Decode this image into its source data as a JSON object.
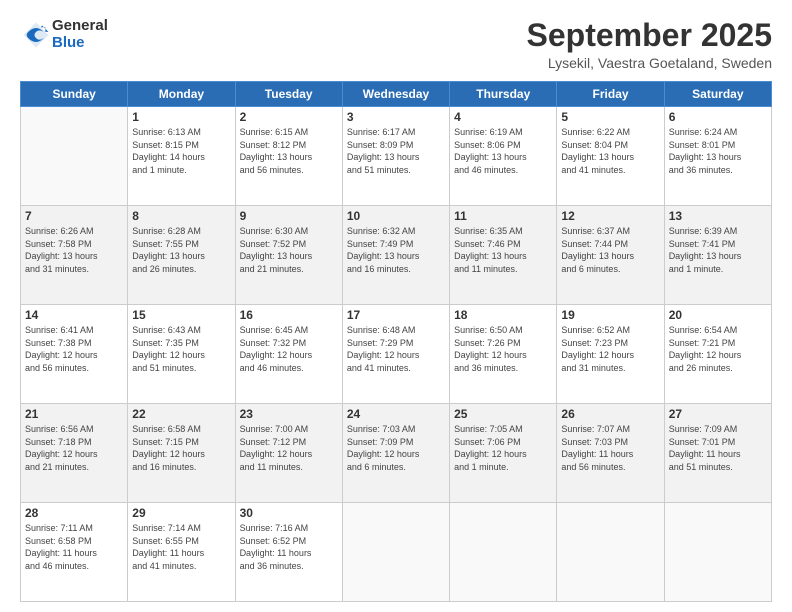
{
  "header": {
    "logo_general": "General",
    "logo_blue": "Blue",
    "month_title": "September 2025",
    "location": "Lysekil, Vaestra Goetaland, Sweden"
  },
  "days_of_week": [
    "Sunday",
    "Monday",
    "Tuesday",
    "Wednesday",
    "Thursday",
    "Friday",
    "Saturday"
  ],
  "weeks": [
    [
      {
        "day": "",
        "info": ""
      },
      {
        "day": "1",
        "info": "Sunrise: 6:13 AM\nSunset: 8:15 PM\nDaylight: 14 hours\nand 1 minute."
      },
      {
        "day": "2",
        "info": "Sunrise: 6:15 AM\nSunset: 8:12 PM\nDaylight: 13 hours\nand 56 minutes."
      },
      {
        "day": "3",
        "info": "Sunrise: 6:17 AM\nSunset: 8:09 PM\nDaylight: 13 hours\nand 51 minutes."
      },
      {
        "day": "4",
        "info": "Sunrise: 6:19 AM\nSunset: 8:06 PM\nDaylight: 13 hours\nand 46 minutes."
      },
      {
        "day": "5",
        "info": "Sunrise: 6:22 AM\nSunset: 8:04 PM\nDaylight: 13 hours\nand 41 minutes."
      },
      {
        "day": "6",
        "info": "Sunrise: 6:24 AM\nSunset: 8:01 PM\nDaylight: 13 hours\nand 36 minutes."
      }
    ],
    [
      {
        "day": "7",
        "info": "Sunrise: 6:26 AM\nSunset: 7:58 PM\nDaylight: 13 hours\nand 31 minutes."
      },
      {
        "day": "8",
        "info": "Sunrise: 6:28 AM\nSunset: 7:55 PM\nDaylight: 13 hours\nand 26 minutes."
      },
      {
        "day": "9",
        "info": "Sunrise: 6:30 AM\nSunset: 7:52 PM\nDaylight: 13 hours\nand 21 minutes."
      },
      {
        "day": "10",
        "info": "Sunrise: 6:32 AM\nSunset: 7:49 PM\nDaylight: 13 hours\nand 16 minutes."
      },
      {
        "day": "11",
        "info": "Sunrise: 6:35 AM\nSunset: 7:46 PM\nDaylight: 13 hours\nand 11 minutes."
      },
      {
        "day": "12",
        "info": "Sunrise: 6:37 AM\nSunset: 7:44 PM\nDaylight: 13 hours\nand 6 minutes."
      },
      {
        "day": "13",
        "info": "Sunrise: 6:39 AM\nSunset: 7:41 PM\nDaylight: 13 hours\nand 1 minute."
      }
    ],
    [
      {
        "day": "14",
        "info": "Sunrise: 6:41 AM\nSunset: 7:38 PM\nDaylight: 12 hours\nand 56 minutes."
      },
      {
        "day": "15",
        "info": "Sunrise: 6:43 AM\nSunset: 7:35 PM\nDaylight: 12 hours\nand 51 minutes."
      },
      {
        "day": "16",
        "info": "Sunrise: 6:45 AM\nSunset: 7:32 PM\nDaylight: 12 hours\nand 46 minutes."
      },
      {
        "day": "17",
        "info": "Sunrise: 6:48 AM\nSunset: 7:29 PM\nDaylight: 12 hours\nand 41 minutes."
      },
      {
        "day": "18",
        "info": "Sunrise: 6:50 AM\nSunset: 7:26 PM\nDaylight: 12 hours\nand 36 minutes."
      },
      {
        "day": "19",
        "info": "Sunrise: 6:52 AM\nSunset: 7:23 PM\nDaylight: 12 hours\nand 31 minutes."
      },
      {
        "day": "20",
        "info": "Sunrise: 6:54 AM\nSunset: 7:21 PM\nDaylight: 12 hours\nand 26 minutes."
      }
    ],
    [
      {
        "day": "21",
        "info": "Sunrise: 6:56 AM\nSunset: 7:18 PM\nDaylight: 12 hours\nand 21 minutes."
      },
      {
        "day": "22",
        "info": "Sunrise: 6:58 AM\nSunset: 7:15 PM\nDaylight: 12 hours\nand 16 minutes."
      },
      {
        "day": "23",
        "info": "Sunrise: 7:00 AM\nSunset: 7:12 PM\nDaylight: 12 hours\nand 11 minutes."
      },
      {
        "day": "24",
        "info": "Sunrise: 7:03 AM\nSunset: 7:09 PM\nDaylight: 12 hours\nand 6 minutes."
      },
      {
        "day": "25",
        "info": "Sunrise: 7:05 AM\nSunset: 7:06 PM\nDaylight: 12 hours\nand 1 minute."
      },
      {
        "day": "26",
        "info": "Sunrise: 7:07 AM\nSunset: 7:03 PM\nDaylight: 11 hours\nand 56 minutes."
      },
      {
        "day": "27",
        "info": "Sunrise: 7:09 AM\nSunset: 7:01 PM\nDaylight: 11 hours\nand 51 minutes."
      }
    ],
    [
      {
        "day": "28",
        "info": "Sunrise: 7:11 AM\nSunset: 6:58 PM\nDaylight: 11 hours\nand 46 minutes."
      },
      {
        "day": "29",
        "info": "Sunrise: 7:14 AM\nSunset: 6:55 PM\nDaylight: 11 hours\nand 41 minutes."
      },
      {
        "day": "30",
        "info": "Sunrise: 7:16 AM\nSunset: 6:52 PM\nDaylight: 11 hours\nand 36 minutes."
      },
      {
        "day": "",
        "info": ""
      },
      {
        "day": "",
        "info": ""
      },
      {
        "day": "",
        "info": ""
      },
      {
        "day": "",
        "info": ""
      }
    ]
  ]
}
